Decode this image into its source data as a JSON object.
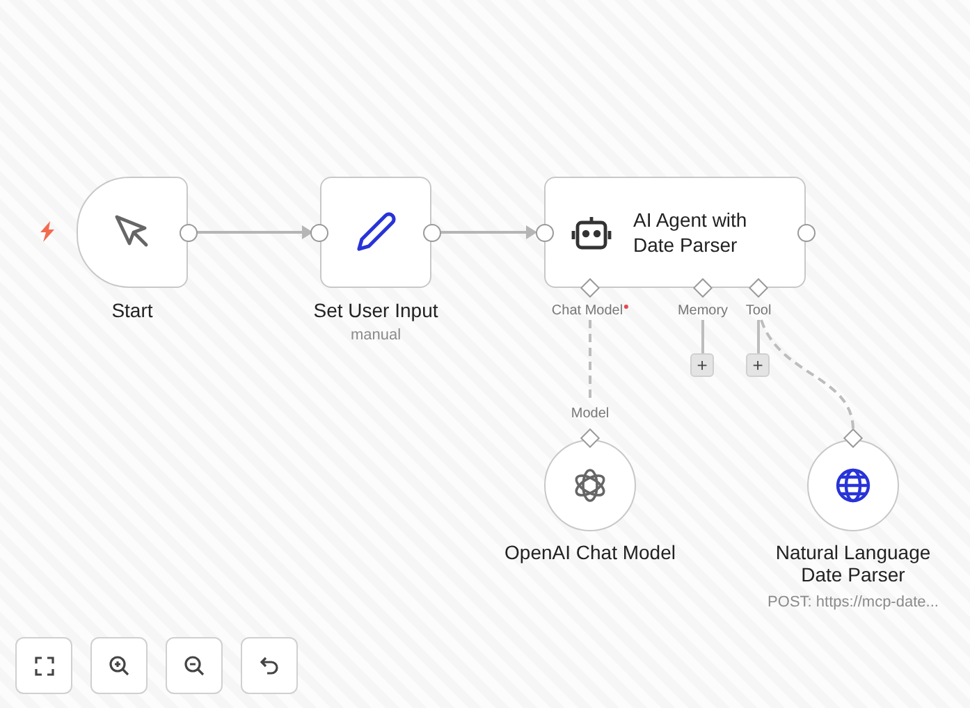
{
  "nodes": [
    {
      "kind": "trigger",
      "title": "Start"
    },
    {
      "kind": "set",
      "title": "Set User Input",
      "subtitle": "manual"
    },
    {
      "kind": "agent",
      "title": "AI Agent with Date Parser",
      "ports": [
        {
          "label": "Chat Model",
          "required": true
        },
        {
          "label": "Memory",
          "required": false,
          "add_button": "+"
        },
        {
          "label": "Tool",
          "required": false,
          "add_button": "+"
        }
      ]
    },
    {
      "kind": "model",
      "title": "OpenAI Chat Model",
      "port_label": "Model"
    },
    {
      "kind": "tool",
      "title": "Natural Language Date Parser",
      "subtitle": "POST: https://mcp-date..."
    }
  ]
}
